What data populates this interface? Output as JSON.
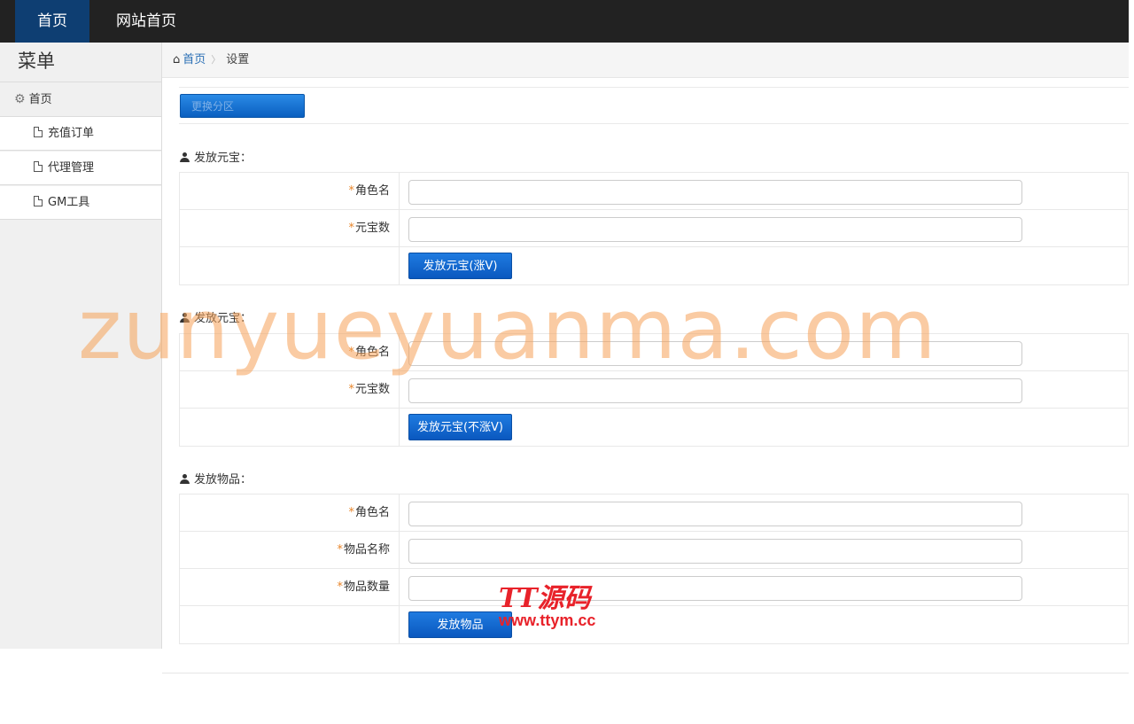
{
  "topnav": {
    "home": "首页",
    "site_home": "网站首页"
  },
  "sidebar": {
    "title": "菜单",
    "home": "首页",
    "items": [
      {
        "label": "充值订单"
      },
      {
        "label": "代理管理"
      },
      {
        "label": "GM工具"
      }
    ]
  },
  "breadcrumb": {
    "home": "首页",
    "separator": "〉",
    "current": "设置"
  },
  "partition": {
    "button_label": "更换分区"
  },
  "sections": [
    {
      "title": "发放元宝：",
      "fields": [
        {
          "required": "*",
          "label": "角色名",
          "value": ""
        },
        {
          "required": "*",
          "label": "元宝数",
          "value": ""
        }
      ],
      "button": "发放元宝(涨V)"
    },
    {
      "title": "发放元宝：",
      "fields": [
        {
          "required": "*",
          "label": "角色名",
          "value": ""
        },
        {
          "required": "*",
          "label": "元宝数",
          "value": ""
        }
      ],
      "button": "发放元宝(不涨V)"
    },
    {
      "title": "发放物品：",
      "fields": [
        {
          "required": "*",
          "label": "角色名",
          "value": ""
        },
        {
          "required": "*",
          "label": "物品名称",
          "value": ""
        },
        {
          "required": "*",
          "label": "物品数量",
          "value": ""
        }
      ],
      "button": "发放物品"
    }
  ],
  "watermarks": {
    "main": "zunyueyuanma.com",
    "logo": "TT源码",
    "url": "www.ttym.cc"
  },
  "colors": {
    "topbar": "#222222",
    "active_nav": "#0e3e72",
    "button": "#0a58bf",
    "required_star": "#e8852a",
    "link": "#2a6fb5"
  }
}
